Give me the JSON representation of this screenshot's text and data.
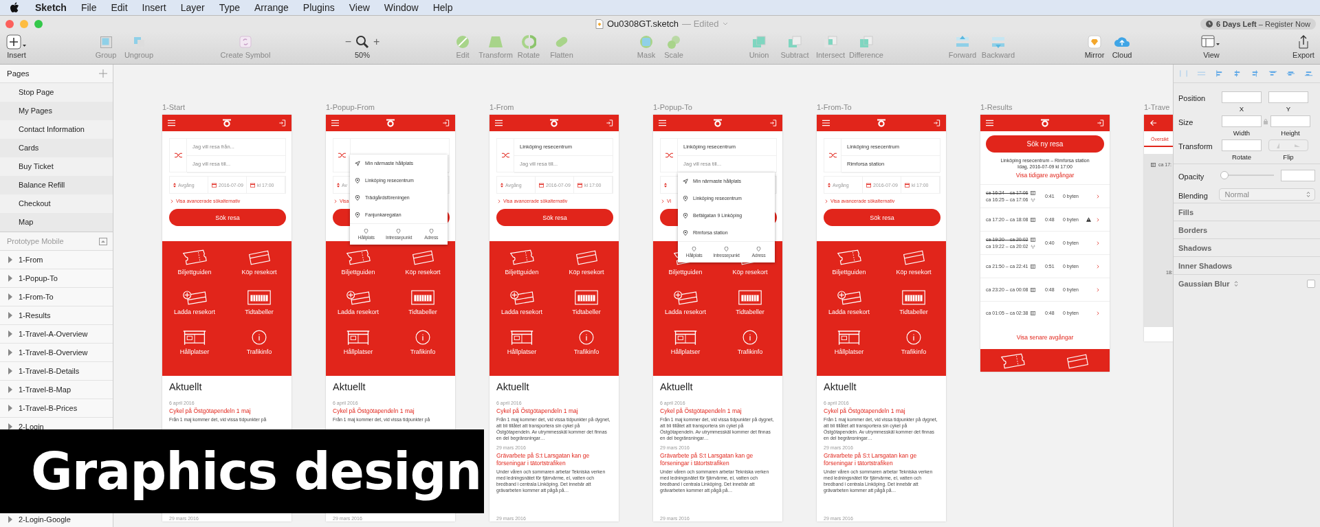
{
  "menu_bar": {
    "app": "Sketch",
    "items": [
      "File",
      "Edit",
      "Insert",
      "Layer",
      "Type",
      "Arrange",
      "Plugins",
      "View",
      "Window",
      "Help"
    ]
  },
  "window": {
    "title": "Ou0308GT.sketch",
    "status": "— Edited",
    "badge": "**6 Days Left** – Register Now"
  },
  "toolbar": [
    [
      {
        "label": "Insert",
        "kind": "insert"
      }
    ],
    [
      {
        "label": "Group",
        "kind": "group"
      },
      {
        "label": "Ungroup",
        "kind": "ungroup"
      }
    ],
    [
      {
        "label": "Create Symbol",
        "kind": "symbol"
      }
    ],
    [
      {
        "label": "50%",
        "kind": "zoom",
        "minus": "−",
        "plus": "+"
      }
    ],
    [
      {
        "label": "Edit",
        "kind": "edit"
      },
      {
        "label": "Transform",
        "kind": "transform"
      },
      {
        "label": "Rotate",
        "kind": "rotate"
      },
      {
        "label": "Flatten",
        "kind": "flatten"
      }
    ],
    [
      {
        "label": "Mask",
        "kind": "mask"
      },
      {
        "label": "Scale",
        "kind": "scale"
      }
    ],
    [
      {
        "label": "Union",
        "kind": "union"
      },
      {
        "label": "Subtract",
        "kind": "subtract"
      },
      {
        "label": "Intersect",
        "kind": "intersect"
      },
      {
        "label": "Difference",
        "kind": "difference"
      }
    ],
    [
      {
        "label": "Forward",
        "kind": "forward"
      },
      {
        "label": "Backward",
        "kind": "backward"
      }
    ],
    [
      {
        "label": "Mirror",
        "kind": "mirror"
      },
      {
        "label": "Cloud",
        "kind": "cloud"
      }
    ],
    [
      {
        "label": "View",
        "kind": "view"
      }
    ],
    [
      {
        "label": "Export",
        "kind": "export"
      }
    ]
  ],
  "sidebar": {
    "pages_title": "Pages",
    "pages": [
      {
        "name": "Stop Page",
        "selected": false
      },
      {
        "name": "My Pages",
        "selected": false
      },
      {
        "name": "Contact Information",
        "selected": false
      },
      {
        "name": "Cards",
        "selected": false
      },
      {
        "name": "Buy Ticket",
        "selected": false
      },
      {
        "name": "Balance Refill",
        "selected": false
      },
      {
        "name": "Checkout",
        "selected": false
      },
      {
        "name": "Map",
        "selected": false
      }
    ],
    "layers_title": "Prototype Mobile",
    "layers": [
      "1-From",
      "1-Popup-To",
      "1-From-To",
      "1-Results",
      "1-Travel-A-Overview",
      "1-Travel-B-Overview",
      "1-Travel-B-Details",
      "1-Travel-B-Map",
      "1-Travel-B-Prices",
      "2-Login"
    ],
    "layers_below_banner": [
      "2-Login-Google"
    ]
  },
  "artboards": [
    {
      "label": "1-Start",
      "kind": "search",
      "from": {
        "placeholder": "Jag vill resa från..."
      },
      "to": {
        "placeholder": "Jag vill resa till..."
      },
      "mode": "Avgång",
      "date": "2016-07-09",
      "time": "kl 17:00",
      "advanced": "Visa avancerade sökalternativ",
      "button": "Sök resa",
      "tiles": [
        {
          "label": "Biljettguiden",
          "kind": "ticket"
        },
        {
          "label": "Köp resekort",
          "kind": "card"
        },
        {
          "label": "Ladda resekort",
          "kind": "card-add"
        },
        {
          "label": "Tidtabeller",
          "kind": "timetable"
        },
        {
          "label": "Hållplatser",
          "kind": "stop"
        },
        {
          "label": "Trafikinfo",
          "kind": "info"
        }
      ],
      "news_heading": "Aktuellt",
      "news": [
        {
          "date": "6 april 2016",
          "title": "Cykel på Östgötapendeln 1 maj",
          "body": "Från 1 maj kommer det, vid vissa tidpunkter på"
        },
        {
          "date": "29 mars 2016"
        }
      ]
    },
    {
      "label": "1-Popup-From",
      "kind": "search",
      "mode": "Av",
      "advanced": "Visa",
      "popup": {
        "items": [
          {
            "kind": "location",
            "label": "Min närmaste hållplats"
          },
          {
            "kind": "pin",
            "label": "Linköping resecentrum"
          },
          {
            "kind": "pin",
            "label": "Trädgårdsföreningen"
          },
          {
            "kind": "pin",
            "label": "Fanjunkaregatan"
          }
        ],
        "tabs": [
          "Hållplats",
          "Intressepunkt",
          "Adress"
        ]
      },
      "tiles": [
        {
          "label": "Biljettguiden",
          "kind": "ticket"
        },
        {
          "label": "Köp resekort",
          "kind": "card"
        },
        {
          "label": "Ladda resekort",
          "kind": "card-add"
        },
        {
          "label": "Tidtabeller",
          "kind": "timetable"
        },
        {
          "label": "Hållplatser",
          "kind": "stop"
        },
        {
          "label": "Trafikinfo",
          "kind": "info"
        }
      ],
      "news_heading": "Aktuellt",
      "news": [
        {
          "date": "6 april 2016",
          "title": "Cykel på Östgötapendeln 1 maj",
          "body": "Från 1 maj kommer det, vid vissa tidpunkter på"
        },
        {
          "date": "29 mars 2016"
        }
      ]
    },
    {
      "label": "1-From",
      "kind": "search",
      "from": {
        "value": "Linköping resecentrum"
      },
      "to": {
        "placeholder": "Jag vill resa till..."
      },
      "mode": "Avgång",
      "date": "2016-07-09",
      "time": "kl 17:00",
      "advanced": "Visa avancerade sökalternativ",
      "button": "Sök resa",
      "tiles": [
        {
          "label": "Biljettguiden",
          "kind": "ticket"
        },
        {
          "label": "Köp resekort",
          "kind": "card"
        },
        {
          "label": "Ladda resekort",
          "kind": "card-add"
        },
        {
          "label": "Tidtabeller",
          "kind": "timetable"
        },
        {
          "label": "Hållplatser",
          "kind": "stop"
        },
        {
          "label": "Trafikinfo",
          "kind": "info"
        }
      ],
      "news_heading": "Aktuellt",
      "news": [
        {
          "date": "6 april 2016",
          "title": "Cykel på Östgötapendeln 1 maj",
          "body": "Från 1 maj kommer det, vid vissa tidpunkter på dygnet, att bli tillåtet att transportera sin cykel på Östgötapendeln. Av utrymmesskäl kommer det finnas en del begränsningar…"
        },
        {
          "date": "29 mars 2016",
          "title": "Grävarbete på S:t Larsgatan kan ge förseningar i tätortstrafiken",
          "body": "Under våren och sommaren arbetar Tekniska verken med ledningsnätet för fjärrvärme, el, vatten och bredband i centrala Linköping. Det innebär att grävarbeten kommer att pågå på…"
        },
        {
          "date": "29 mars 2016"
        }
      ]
    },
    {
      "label": "1-Popup-To",
      "kind": "search",
      "from": {
        "value": "Linköping resecentrum"
      },
      "to": {
        "placeholder": "Jag vill resa till..."
      },
      "advanced": "Vi",
      "popup": {
        "items": [
          {
            "kind": "location",
            "label": "Min närmaste hållplats"
          },
          {
            "kind": "pin",
            "label": "Linköping resecentrum"
          },
          {
            "kind": "pin",
            "label": "Befälgatan 9 Linköping"
          },
          {
            "kind": "pin",
            "label": "Rimforsa station"
          }
        ],
        "tabs": [
          "Hållplats",
          "Intressepunkt",
          "Adress"
        ]
      },
      "tiles": [
        {
          "label": "Biljettguiden",
          "kind": "ticket"
        },
        {
          "label": "Köp resekort",
          "kind": "card"
        },
        {
          "label": "Ladda resekort",
          "kind": "card-add"
        },
        {
          "label": "Tidtabeller",
          "kind": "timetable"
        },
        {
          "label": "Hållplatser",
          "kind": "stop"
        },
        {
          "label": "Trafikinfo",
          "kind": "info"
        }
      ],
      "news_heading": "Aktuellt",
      "news": [
        {
          "date": "6 april 2016",
          "title": "Cykel på Östgötapendeln 1 maj",
          "body": "Från 1 maj kommer det, vid vissa tidpunkter på dygnet, att bli tillåtet att transportera sin cykel på Östgötapendeln. Av utrymmesskäl kommer det finnas en del begränsningar…"
        },
        {
          "date": "29 mars 2016",
          "title": "Grävarbete på S:t Larsgatan kan ge förseningar i tätortstrafiken",
          "body": "Under våren och sommaren arbetar Tekniska verken med ledningsnätet för fjärrvärme, el, vatten och bredband i centrala Linköping. Det innebär att grävarbeten kommer att pågå på…"
        },
        {
          "date": "29 mars 2016"
        }
      ]
    },
    {
      "label": "1-From-To",
      "kind": "search",
      "from": {
        "value": "Linköping resecentrum"
      },
      "to": {
        "value": "Rimforsa station"
      },
      "mode": "Avgång",
      "date": "2016-07-09",
      "time": "kl 17:00",
      "advanced": "Visa avancerade sökalternativ",
      "button": "Sök resa",
      "tiles": [
        {
          "label": "Biljettguiden",
          "kind": "ticket"
        },
        {
          "label": "Köp resekort",
          "kind": "card"
        },
        {
          "label": "Ladda resekort",
          "kind": "card-add"
        },
        {
          "label": "Tidtabeller",
          "kind": "timetable"
        },
        {
          "label": "Hållplatser",
          "kind": "stop"
        },
        {
          "label": "Trafikinfo",
          "kind": "info"
        }
      ],
      "news_heading": "Aktuellt",
      "news": [
        {
          "date": "6 april 2016",
          "title": "Cykel på Östgötapendeln 1 maj",
          "body": "Från 1 maj kommer det, vid vissa tidpunkter på dygnet, att bli tillåtet att transportera sin cykel på Östgötapendeln. Av utrymmesskäl kommer det finnas en del begränsningar…"
        },
        {
          "date": "29 mars 2016",
          "title": "Grävarbete på S:t Larsgatan kan ge förseningar i tätortstrafiken",
          "body": "Under våren och sommaren arbetar Tekniska verken med ledningsnätet för fjärrvärme, el, vatten och bredband i centrala Linköping. Det innebär att grävarbeten kommer att pågå på…"
        },
        {
          "date": "29 mars 2016"
        }
      ]
    },
    {
      "label": "1-Results",
      "kind": "results",
      "button": "Sök ny resa",
      "route": "Linköping resecentrum – Rimforsa station",
      "when": "Idag, 2016-07-09 kl 17:00",
      "earlier": "Visa tidigare avgångar",
      "later": "Visa senare avgångar",
      "trips": [
        {
          "old": "ca 16:24 – ca 17:06",
          "time": "ca 16:25 – ca 17:06",
          "duration": "0:41",
          "changes": "0 byten",
          "warning": false
        },
        {
          "time": "ca 17:20 – ca 18:08",
          "duration": "0:48",
          "changes": "0 byten",
          "warning": true
        },
        {
          "old": "ca 19:20 – ca 20:02",
          "time": "ca 19:22 – ca 20:02",
          "duration": "0:40",
          "changes": "0 byten",
          "warning": false
        },
        {
          "time": "ca 21:50 – ca 22:41",
          "duration": "0:51",
          "changes": "0 byten",
          "warning": false
        },
        {
          "time": "ca 23:20 – ca 00:08",
          "duration": "0:48",
          "changes": "0 byten",
          "warning": false
        },
        {
          "time": "ca 01:05 – ca 02:38",
          "duration": "0:48",
          "changes": "0 byten",
          "warning": false
        }
      ],
      "tiles": [
        {
          "kind": "ticket"
        },
        {
          "kind": "card"
        }
      ]
    },
    {
      "label": "1-Trave",
      "kind": "travel",
      "tab": "Översikt",
      "row": "ca 17:",
      "time": "18:"
    }
  ],
  "inspector": {
    "position": "Position",
    "x": "X",
    "y": "Y",
    "size": "Size",
    "width": "Width",
    "height": "Height",
    "transform": "Transform",
    "rotate": "Rotate",
    "flip": "Flip",
    "opacity": "Opacity",
    "opacity_slider": {
      "level": 0
    },
    "blending": "Blending",
    "blend_mode": "Normal",
    "sections": [
      {
        "label": "Fills"
      },
      {
        "label": "Borders"
      },
      {
        "label": "Shadows"
      },
      {
        "label": "Inner Shadows"
      },
      {
        "label": "Gaussian Blur",
        "checked": false
      }
    ]
  },
  "banner": "Graphics design"
}
